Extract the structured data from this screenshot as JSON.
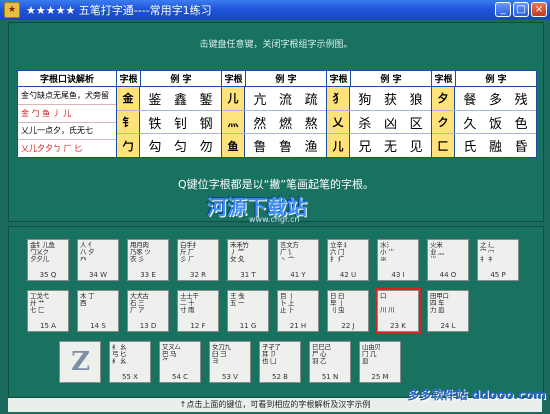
{
  "window": {
    "icon_text": "★",
    "title": "★★★★★ 五笔打字通----常用字1练习",
    "buttons": [
      "_",
      "□",
      "×"
    ]
  },
  "instruction": "击键盘任意键，关闭字根组字示例图。",
  "mnemonic": {
    "header": "字根口诀解析",
    "lines": [
      {
        "text": "金勺缺点无尾鱼，犬旁留",
        "red": false
      },
      {
        "text": "金  勹  鱼     丿 儿",
        "red": true
      },
      {
        "text": "乂儿一点夕，氏无七",
        "red": false
      },
      {
        "text": "乂儿夕夕ㄅ  厂 匕",
        "red": true
      }
    ]
  },
  "columns": [
    {
      "head_root": "字根",
      "head_ex": "例 字",
      "rows": [
        {
          "root": "金",
          "examples": [
            "鉴",
            "鑫",
            "錾"
          ]
        },
        {
          "root": "钅",
          "examples": [
            "铁",
            "钊",
            "钢"
          ]
        },
        {
          "root": "勹",
          "examples": [
            "勾",
            "匀",
            "勿"
          ]
        }
      ]
    },
    {
      "head_root": "字根",
      "head_ex": "例 字",
      "rows": [
        {
          "root": "儿",
          "examples": [
            "亢",
            "流",
            "疏"
          ]
        },
        {
          "root": "灬",
          "examples": [
            "然",
            "燃",
            "熬"
          ]
        },
        {
          "root": "鱼",
          "examples": [
            "鲁",
            "鲁",
            "渔"
          ]
        }
      ]
    },
    {
      "head_root": "字根",
      "head_ex": "例 字",
      "rows": [
        {
          "root": "犭",
          "examples": [
            "狗",
            "获",
            "狼"
          ]
        },
        {
          "root": "乂",
          "examples": [
            "杀",
            "凶",
            "区"
          ]
        },
        {
          "root": "儿",
          "examples": [
            "兄",
            "无",
            "见"
          ]
        }
      ]
    },
    {
      "head_root": "字根",
      "head_ex": "例 字",
      "rows": [
        {
          "root": "夕",
          "examples": [
            "餐",
            "多",
            "残"
          ]
        },
        {
          "root": "ク",
          "examples": [
            "久",
            "饭",
            "色"
          ]
        },
        {
          "root": "匚",
          "examples": [
            "氏",
            "融",
            "昏"
          ]
        }
      ]
    }
  ],
  "description": "Q键位字根都是以“撇”笔画起笔的字根。",
  "watermark": {
    "main": "河源下载站",
    "sub": "www.cngr.cn"
  },
  "keys": [
    {
      "id": "35Q",
      "glyphs": "金钅儿鱼\n勹乂ク\n夕夕儿",
      "label": "35 Q"
    },
    {
      "id": "34W",
      "glyphs": "人 亻\n八 夕\n癶",
      "label": "34 W"
    },
    {
      "id": "33E",
      "glyphs": "用月肉\n乃豕 ツ\n衣 彡",
      "label": "33 E"
    },
    {
      "id": "32R",
      "glyphs": "白手扌\n斤 厂\n彡 ㄏ",
      "label": "32 R"
    },
    {
      "id": "31T",
      "glyphs": "禾禾竹\n丿 ⺮\n攵 夂",
      "label": "31 T"
    },
    {
      "id": "41Y",
      "glyphs": "言文方\n广 讠\n丶 亠",
      "label": "41 Y"
    },
    {
      "id": "42U",
      "glyphs": "立辛丬\n六 门\n扌 疒",
      "label": "42 U"
    },
    {
      "id": "43I",
      "glyphs": "水氵\n小 ⺌\n氺",
      "label": "43 I"
    },
    {
      "id": "44O",
      "glyphs": "火米\n业 灬\n⺌",
      "label": "44 O"
    },
    {
      "id": "45P",
      "glyphs": "之 辶\n宀 冖\n礻 衤",
      "label": "45 P"
    },
    {
      "id": "15A",
      "glyphs": "工戈弋\n廾 艹\n七 匚",
      "label": "15 A"
    },
    {
      "id": "14S",
      "glyphs": "木 丁\n西",
      "label": "14 S"
    },
    {
      "id": "13D",
      "glyphs": "大犬古\n石 三\n厂 ア",
      "label": "13 D"
    },
    {
      "id": "12F",
      "glyphs": "土士干\n二 十\n寸 雨",
      "label": "12 F"
    },
    {
      "id": "11G",
      "glyphs": "王 戋\n五 一",
      "label": "11 G"
    },
    {
      "id": "21H",
      "glyphs": "目 丨\n卜 上\n止 ⺊",
      "label": "21 H"
    },
    {
      "id": "22J",
      "glyphs": "日 曰\n早 丨\n刂 虫",
      "label": "22 J"
    },
    {
      "id": "23K",
      "glyphs": "口\n\n川 川",
      "label": "23 K",
      "selected": true
    },
    {
      "id": "24L",
      "glyphs": "田甲口\n四 车\n力 皿",
      "label": "24 L"
    },
    {
      "id": "Z",
      "glyphs": "Z",
      "label": "",
      "big": true
    },
    {
      "id": "55X",
      "glyphs": "纟 幺\n弓 匕\n纟 幺",
      "label": "55 X"
    },
    {
      "id": "54C",
      "glyphs": "又ㄡ厶\n巴 马\n⺈",
      "label": "54 C"
    },
    {
      "id": "53V",
      "glyphs": "女刀九\n臼 彐\nヨ",
      "label": "53 V"
    },
    {
      "id": "52B",
      "glyphs": "子孑了\n耳 卩\n也 凵",
      "label": "52 B"
    },
    {
      "id": "51N",
      "glyphs": "已巳己\n尸 心\n羽 乙",
      "label": "51 N"
    },
    {
      "id": "25M",
      "glyphs": "山由贝\n冂 几\n皿",
      "label": "25 M"
    }
  ],
  "footer": "↑点击上面的键位，可看到相应的字根解析及汉字示例",
  "watermark2": "多多软件站 ddooo.com"
}
